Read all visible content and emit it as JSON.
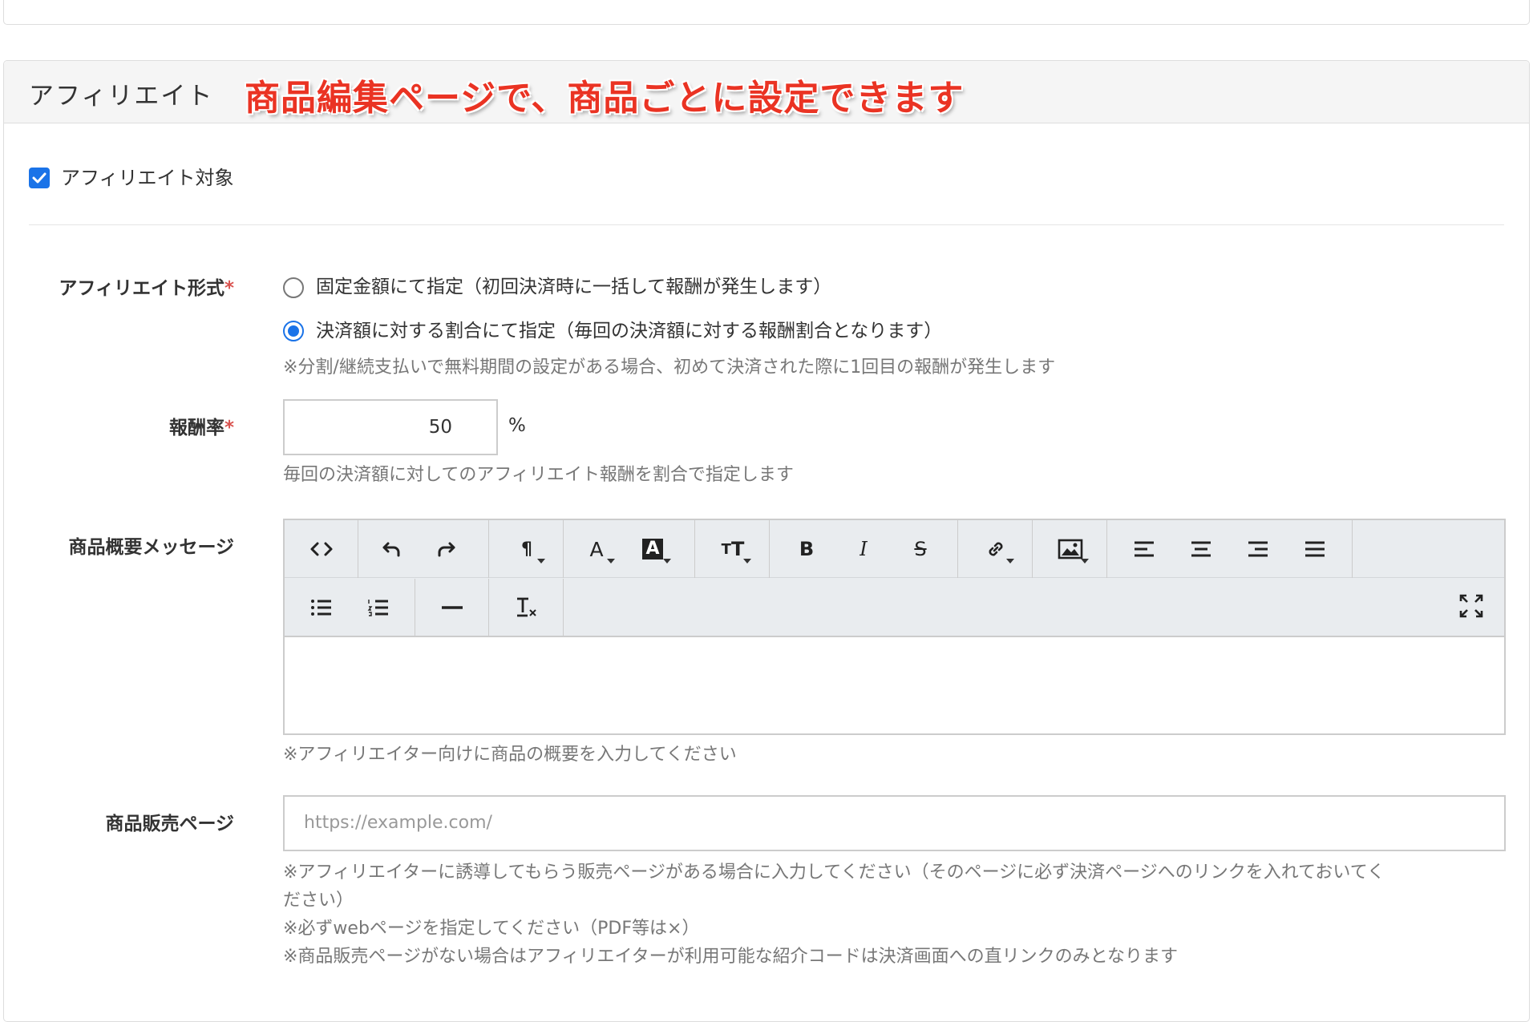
{
  "section": {
    "title": "アフィリエイト",
    "annotation": "商品編集ページで、商品ごとに設定できます"
  },
  "affiliate_target": {
    "label": "アフィリエイト対象",
    "checked": true
  },
  "format": {
    "label": "アフィリエイト形式",
    "required_mark": "*",
    "options": [
      {
        "label": "固定金額にて指定（初回決済時に一括して報酬が発生します）",
        "selected": false
      },
      {
        "label": "決済額に対する割合にて指定（毎回の決済額に対する報酬割合となります）",
        "selected": true
      }
    ],
    "help": "※分割/継続支払いで無料期間の設定がある場合、初めて決済された際に1回目の報酬が発生します"
  },
  "rate": {
    "label": "報酬率",
    "required_mark": "*",
    "value": "50",
    "unit": "%",
    "help": "毎回の決済額に対してのアフィリエイト報酬を割合で指定します"
  },
  "message": {
    "label": "商品概要メッセージ",
    "toolbar_icons": [
      "code-view-icon",
      "undo-icon",
      "redo-icon",
      "paragraph-icon",
      "font-color-icon",
      "highlight-color-icon",
      "font-size-icon",
      "bold-icon",
      "italic-icon",
      "strikethrough-icon",
      "link-icon",
      "image-icon",
      "align-left-icon",
      "align-center-icon",
      "align-right-icon",
      "align-justify-icon",
      "bullet-list-icon",
      "numbered-list-icon",
      "horizontal-rule-icon",
      "clear-format-icon",
      "fullscreen-icon"
    ],
    "help": "※アフィリエイター向けに商品の概要を入力してください"
  },
  "sales_page": {
    "label": "商品販売ページ",
    "placeholder": "https://example.com/",
    "help_lines": [
      "※アフィリエイターに誘導してもらう販売ページがある場合に入力してください（そのページに必ず決済ページへのリンクを入れておいてく",
      "ださい）",
      "※必ずwebページを指定してください（PDF等は×）",
      "※商品販売ページがない場合はアフィリエイターが利用可能な紹介コードは決済画面への直リンクのみとなります"
    ]
  },
  "colors": {
    "accent": "#1a73e8",
    "annotation": "#ea3323",
    "required": "#d9534f",
    "help_text": "#777777"
  }
}
